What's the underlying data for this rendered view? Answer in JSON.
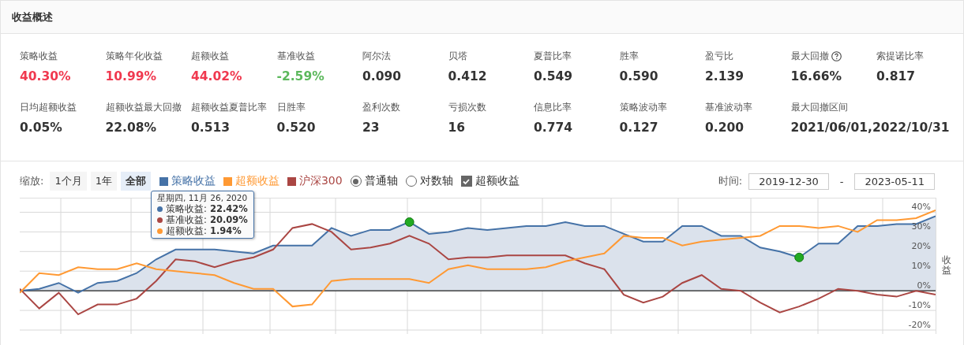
{
  "section_title": "收益概述",
  "metrics": [
    {
      "label": "策略收益",
      "value": "40.30%",
      "color": "#f0394f"
    },
    {
      "label": "策略年化收益",
      "value": "10.99%",
      "color": "#f0394f"
    },
    {
      "label": "超额收益",
      "value": "44.02%",
      "color": "#f0394f"
    },
    {
      "label": "基准收益",
      "value": "-2.59%",
      "color": "#5cb85c"
    },
    {
      "label": "阿尔法",
      "value": "0.090",
      "color": "#333333"
    },
    {
      "label": "贝塔",
      "value": "0.412",
      "color": "#333333"
    },
    {
      "label": "夏普比率",
      "value": "0.549",
      "color": "#333333"
    },
    {
      "label": "胜率",
      "value": "0.590",
      "color": "#333333"
    },
    {
      "label": "盈亏比",
      "value": "2.139",
      "color": "#333333"
    },
    {
      "label": "最大回撤",
      "value": "16.66%",
      "color": "#333333",
      "help": true
    },
    {
      "label": "索提诺比率",
      "value": "0.817",
      "color": "#333333"
    },
    {
      "label": "日均超额收益",
      "value": "0.05%",
      "color": "#333333"
    },
    {
      "label": "超额收益最大回撤",
      "value": "22.08%",
      "color": "#333333"
    },
    {
      "label": "超额收益夏普比率",
      "value": "0.513",
      "color": "#333333"
    },
    {
      "label": "日胜率",
      "value": "0.520",
      "color": "#333333"
    },
    {
      "label": "盈利次数",
      "value": "23",
      "color": "#333333"
    },
    {
      "label": "亏损次数",
      "value": "16",
      "color": "#333333"
    },
    {
      "label": "信息比率",
      "value": "0.774",
      "color": "#333333"
    },
    {
      "label": "策略波动率",
      "value": "0.127",
      "color": "#333333"
    },
    {
      "label": "基准波动率",
      "value": "0.200",
      "color": "#333333"
    },
    {
      "label": "最大回撤区间",
      "value": "2021/06/01,2022/10/31",
      "color": "#333333"
    }
  ],
  "zoom": {
    "label": "缩放:",
    "options": [
      {
        "label": "1个月",
        "selected": false
      },
      {
        "label": "1年",
        "selected": false
      },
      {
        "label": "全部",
        "selected": true
      }
    ]
  },
  "legend": [
    {
      "label": "策略收益",
      "color": "#4572a7"
    },
    {
      "label": "超额收益",
      "color": "#ff9933"
    },
    {
      "label": "沪深300",
      "color": "#aa4643"
    }
  ],
  "axis_modes": [
    {
      "label": "普通轴",
      "selected": true
    },
    {
      "label": "对数轴",
      "selected": false
    }
  ],
  "excess_toggle": {
    "label": "超额收益",
    "checked": true
  },
  "time": {
    "label": "时间:",
    "start": "2019-12-30",
    "separator": "-",
    "end": "2023-05-11"
  },
  "tooltip": {
    "date": "星期四, 11月 26, 2020",
    "separator": ":",
    "values": [
      "22.42%",
      "20.09%",
      "1.94%"
    ]
  },
  "chart_data": {
    "type": "line",
    "ylabel": "收益",
    "ylim": [
      -22,
      47
    ],
    "grid": true,
    "yticks": [
      {
        "value": -20,
        "label": "-20%"
      },
      {
        "value": -10,
        "label": "-10%"
      },
      {
        "value": 0,
        "label": "0%"
      },
      {
        "value": 10,
        "label": "10%"
      },
      {
        "value": 20,
        "label": "20%"
      },
      {
        "value": 30,
        "label": "30%"
      },
      {
        "value": 40,
        "label": "40%"
      }
    ],
    "series": [
      {
        "name": "策略收益",
        "color": "#4572a7",
        "values": [
          0,
          1,
          4,
          -1,
          4,
          5,
          9,
          16,
          21,
          21,
          21,
          20,
          19,
          23,
          23,
          23,
          32,
          28,
          31,
          31,
          35,
          29,
          30,
          32,
          31,
          32,
          33,
          33,
          35,
          33,
          33,
          29,
          25,
          25,
          33,
          33,
          28,
          28,
          22,
          20,
          17,
          24,
          24,
          33,
          33,
          34,
          34,
          38
        ]
      },
      {
        "name": "基准收益",
        "color": "#aa4643",
        "values": [
          1,
          -9,
          -1,
          -12,
          -7,
          -7,
          -4,
          5,
          16,
          15,
          12,
          15,
          17,
          21,
          32,
          34,
          30,
          21,
          22,
          24,
          28,
          24,
          16,
          17,
          17,
          18,
          18,
          18,
          18,
          14,
          11,
          -2,
          -6,
          -3,
          4,
          8,
          1,
          0,
          -6,
          -11,
          -8,
          -4,
          1,
          0,
          -2,
          -3,
          0,
          -2
        ]
      },
      {
        "name": "超额收益",
        "color": "#ff9933",
        "values": [
          -1,
          9,
          8,
          12,
          11,
          11,
          14,
          11,
          10,
          9,
          8,
          4,
          1,
          1,
          -8,
          -7,
          5,
          6,
          6,
          6,
          6,
          4,
          11,
          13,
          11,
          11,
          11,
          12,
          15,
          17,
          19,
          28,
          27,
          27,
          23,
          25,
          26,
          27,
          28,
          33,
          33,
          32,
          33,
          30,
          36,
          36,
          37,
          41
        ]
      }
    ]
  }
}
